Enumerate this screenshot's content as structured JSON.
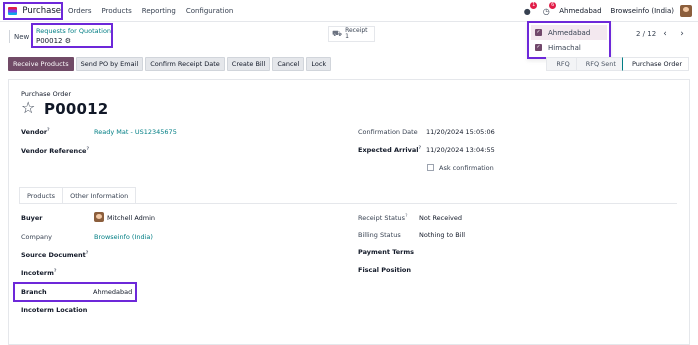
{
  "navbar": {
    "app_name": "Purchase",
    "menu": [
      "Orders",
      "Products",
      "Reporting",
      "Configuration"
    ],
    "chat_count": "1",
    "activity_count": "6",
    "current_company": "Ahmedabad",
    "company_name": "Browseinfo (India)"
  },
  "company_dropdown": {
    "items": [
      {
        "label": "Ahmedabad",
        "checked": true
      },
      {
        "label": "Himachal",
        "checked": true
      }
    ]
  },
  "control": {
    "new_label": "New",
    "breadcrumb_parent": "Requests for Quotation",
    "breadcrumb_current": "P00012",
    "receipt_label": "Receipt",
    "receipt_count": "1",
    "pager": "2 / 12"
  },
  "actions": [
    "Receive Products",
    "Send PO by Email",
    "Confirm Receipt Date",
    "Create Bill",
    "Cancel",
    "Lock"
  ],
  "statusbar": [
    "RFQ",
    "RFQ Sent",
    "Purchase Order"
  ],
  "form": {
    "title_label": "Purchase Order",
    "po_number": "P00012",
    "vendor_label": "Vendor",
    "vendor_value": "Ready Mat - US12345675",
    "vendor_ref_label": "Vendor Reference",
    "confirmation_date_label": "Confirmation Date",
    "confirmation_date_value": "11/20/2024 15:05:06",
    "expected_arrival_label": "Expected Arrival",
    "expected_arrival_value": "11/20/2024 13:04:55",
    "ask_confirmation_label": "Ask confirmation",
    "tabs": [
      "Products",
      "Other Information"
    ],
    "buyer_label": "Buyer",
    "buyer_value": "Mitchell Admin",
    "company_label": "Company",
    "company_value": "Browseinfo (India)",
    "source_doc_label": "Source Document",
    "incoterm_label": "Incoterm",
    "branch_label": "Branch",
    "branch_value": "Ahmedabad",
    "incoterm_location_label": "Incoterm Location",
    "receipt_status_label": "Receipt Status",
    "receipt_status_value": "Not Received",
    "billing_status_label": "Billing Status",
    "billing_status_value": "Nothing to Bill",
    "payment_terms_label": "Payment Terms",
    "fiscal_position_label": "Fiscal Position"
  }
}
